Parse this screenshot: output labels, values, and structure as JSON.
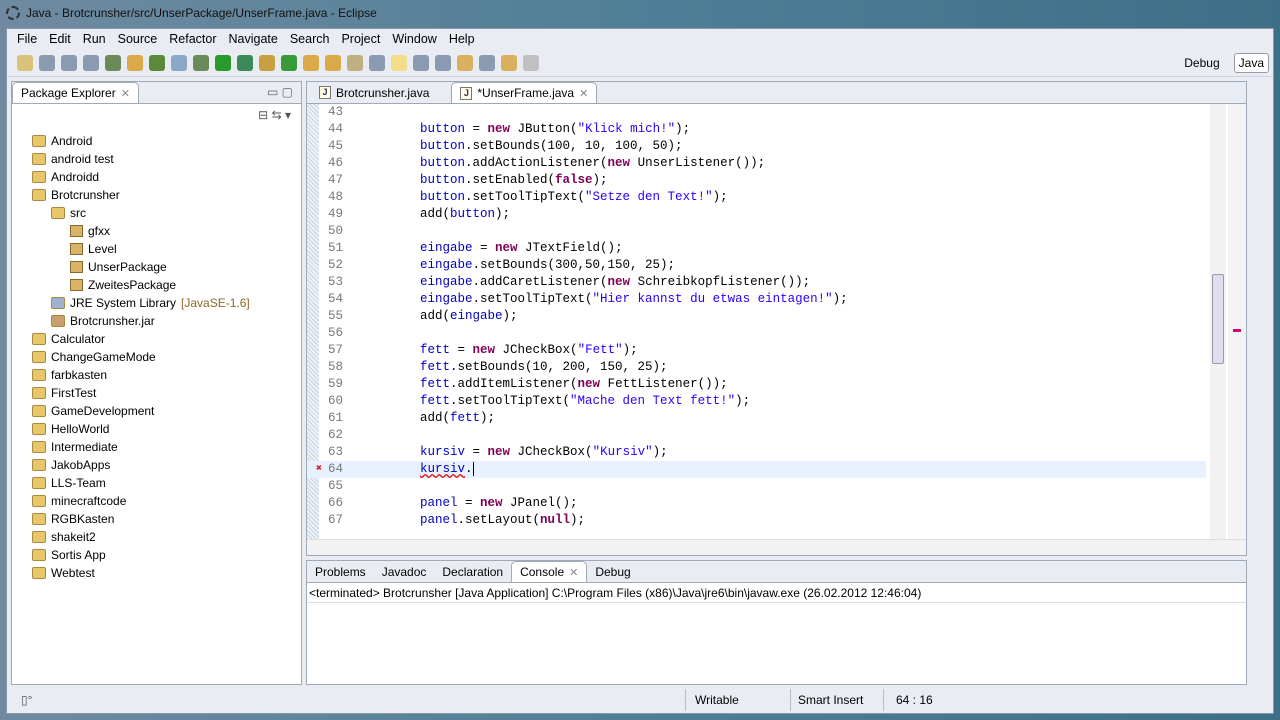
{
  "window": {
    "title": "Java - Brotcrunsher/src/UnserPackage/UnserFrame.java - Eclipse"
  },
  "menu": [
    "File",
    "Edit",
    "Run",
    "Source",
    "Refactor",
    "Navigate",
    "Search",
    "Project",
    "Window",
    "Help"
  ],
  "perspectives": {
    "debug": "Debug",
    "java": "Java"
  },
  "explorer": {
    "title": "Package Explorer",
    "items": [
      {
        "label": "Android",
        "level": 0,
        "type": "project"
      },
      {
        "label": "android test",
        "level": 0,
        "type": "project"
      },
      {
        "label": "Androidd",
        "level": 0,
        "type": "project"
      },
      {
        "label": "Brotcrunsher",
        "level": 0,
        "type": "project"
      },
      {
        "label": "src",
        "level": 1,
        "type": "src"
      },
      {
        "label": "gfxx",
        "level": 2,
        "type": "package"
      },
      {
        "label": "Level",
        "level": 2,
        "type": "package"
      },
      {
        "label": "UnserPackage",
        "level": 2,
        "type": "package"
      },
      {
        "label": "ZweitesPackage",
        "level": 2,
        "type": "package"
      },
      {
        "label": "JRE System Library",
        "suffix": "[JavaSE-1.6]",
        "level": 1,
        "type": "library"
      },
      {
        "label": "Brotcrunsher.jar",
        "level": 1,
        "type": "jar"
      },
      {
        "label": "Calculator",
        "level": 0,
        "type": "project"
      },
      {
        "label": "ChangeGameMode",
        "level": 0,
        "type": "project"
      },
      {
        "label": "farbkasten",
        "level": 0,
        "type": "project"
      },
      {
        "label": "FirstTest",
        "level": 0,
        "type": "project"
      },
      {
        "label": "GameDevelopment",
        "level": 0,
        "type": "project"
      },
      {
        "label": "HelloWorld",
        "level": 0,
        "type": "project"
      },
      {
        "label": "Intermediate",
        "level": 0,
        "type": "project"
      },
      {
        "label": "JakobApps",
        "level": 0,
        "type": "project"
      },
      {
        "label": "LLS-Team",
        "level": 0,
        "type": "project"
      },
      {
        "label": "minecraftcode",
        "level": 0,
        "type": "project"
      },
      {
        "label": "RGBKasten",
        "level": 0,
        "type": "project"
      },
      {
        "label": "shakeit2",
        "level": 0,
        "type": "project"
      },
      {
        "label": "Sortis App",
        "level": 0,
        "type": "project"
      },
      {
        "label": "Webtest",
        "level": 0,
        "type": "project"
      }
    ]
  },
  "editor": {
    "tabs": [
      {
        "label": "Brotcrunsher.java",
        "active": false
      },
      {
        "label": "*UnserFrame.java",
        "active": true
      }
    ],
    "current_line": 64,
    "lines": [
      {
        "n": "43",
        "t": []
      },
      {
        "n": "44",
        "t": [
          [
            "f",
            "button"
          ],
          [
            "p",
            " = "
          ],
          [
            "k",
            "new"
          ],
          [
            "p",
            " JButton("
          ],
          [
            "s",
            "\"Klick mich!\""
          ],
          [
            "p",
            ");"
          ]
        ]
      },
      {
        "n": "45",
        "t": [
          [
            "f",
            "button"
          ],
          [
            "p",
            ".setBounds(100, 10, 100, 50);"
          ]
        ]
      },
      {
        "n": "46",
        "t": [
          [
            "f",
            "button"
          ],
          [
            "p",
            ".addActionListener("
          ],
          [
            "k",
            "new"
          ],
          [
            "p",
            " UnserListener());"
          ]
        ]
      },
      {
        "n": "47",
        "t": [
          [
            "f",
            "button"
          ],
          [
            "p",
            ".setEnabled("
          ],
          [
            "k",
            "false"
          ],
          [
            "p",
            ");"
          ]
        ]
      },
      {
        "n": "48",
        "t": [
          [
            "f",
            "button"
          ],
          [
            "p",
            ".setToolTipText("
          ],
          [
            "s",
            "\"Setze den Text!\""
          ],
          [
            "p",
            ");"
          ]
        ]
      },
      {
        "n": "49",
        "t": [
          [
            "p",
            "add("
          ],
          [
            "f",
            "button"
          ],
          [
            "p",
            ");"
          ]
        ]
      },
      {
        "n": "50",
        "t": []
      },
      {
        "n": "51",
        "t": [
          [
            "f",
            "eingabe"
          ],
          [
            "p",
            " = "
          ],
          [
            "k",
            "new"
          ],
          [
            "p",
            " JTextField();"
          ]
        ]
      },
      {
        "n": "52",
        "t": [
          [
            "f",
            "eingabe"
          ],
          [
            "p",
            ".setBounds(300,50,150, 25);"
          ]
        ]
      },
      {
        "n": "53",
        "t": [
          [
            "f",
            "eingabe"
          ],
          [
            "p",
            ".addCaretListener("
          ],
          [
            "k",
            "new"
          ],
          [
            "p",
            " SchreibkopfListener());"
          ]
        ]
      },
      {
        "n": "54",
        "t": [
          [
            "f",
            "eingabe"
          ],
          [
            "p",
            ".setToolTipText("
          ],
          [
            "s",
            "\"Hier kannst du etwas eintagen!\""
          ],
          [
            "p",
            ");"
          ]
        ]
      },
      {
        "n": "55",
        "t": [
          [
            "p",
            "add("
          ],
          [
            "f",
            "eingabe"
          ],
          [
            "p",
            ");"
          ]
        ]
      },
      {
        "n": "56",
        "t": []
      },
      {
        "n": "57",
        "t": [
          [
            "f",
            "fett"
          ],
          [
            "p",
            " = "
          ],
          [
            "k",
            "new"
          ],
          [
            "p",
            " JCheckBox("
          ],
          [
            "s",
            "\"Fett\""
          ],
          [
            "p",
            ");"
          ]
        ]
      },
      {
        "n": "58",
        "t": [
          [
            "f",
            "fett"
          ],
          [
            "p",
            ".setBounds(10, 200, 150, 25);"
          ]
        ]
      },
      {
        "n": "59",
        "t": [
          [
            "f",
            "fett"
          ],
          [
            "p",
            ".addItemListener("
          ],
          [
            "k",
            "new"
          ],
          [
            "p",
            " FettListener());"
          ]
        ]
      },
      {
        "n": "60",
        "t": [
          [
            "f",
            "fett"
          ],
          [
            "p",
            ".setToolTipText("
          ],
          [
            "s",
            "\"Mache den Text fett!\""
          ],
          [
            "p",
            ");"
          ]
        ]
      },
      {
        "n": "61",
        "t": [
          [
            "p",
            "add("
          ],
          [
            "f",
            "fett"
          ],
          [
            "p",
            ");"
          ]
        ]
      },
      {
        "n": "62",
        "t": []
      },
      {
        "n": "63",
        "t": [
          [
            "f",
            "kursiv"
          ],
          [
            "p",
            " = "
          ],
          [
            "k",
            "new"
          ],
          [
            "p",
            " JCheckBox("
          ],
          [
            "s",
            "\"Kursiv\""
          ],
          [
            "p",
            ");"
          ]
        ]
      },
      {
        "n": "64",
        "t": [
          [
            "f err",
            "kursiv"
          ],
          [
            "p",
            "."
          ]
        ]
      },
      {
        "n": "65",
        "t": []
      },
      {
        "n": "66",
        "t": [
          [
            "f",
            "panel"
          ],
          [
            "p",
            " = "
          ],
          [
            "k",
            "new"
          ],
          [
            "p",
            " JPanel();"
          ]
        ]
      },
      {
        "n": "67",
        "t": [
          [
            "f",
            "panel"
          ],
          [
            "p",
            ".setLayout("
          ],
          [
            "k",
            "null"
          ],
          [
            "p",
            ");"
          ]
        ]
      }
    ]
  },
  "bottom": {
    "tabs": [
      "Problems",
      "Javadoc",
      "Declaration",
      "Console",
      "Debug"
    ],
    "active": "Console",
    "console_header": "<terminated> Brotcrunsher [Java Application] C:\\Program Files (x86)\\Java\\jre6\\bin\\javaw.exe (26.02.2012 12:46:04)"
  },
  "status": {
    "writable": "Writable",
    "insert": "Smart Insert",
    "position": "64 : 16"
  }
}
